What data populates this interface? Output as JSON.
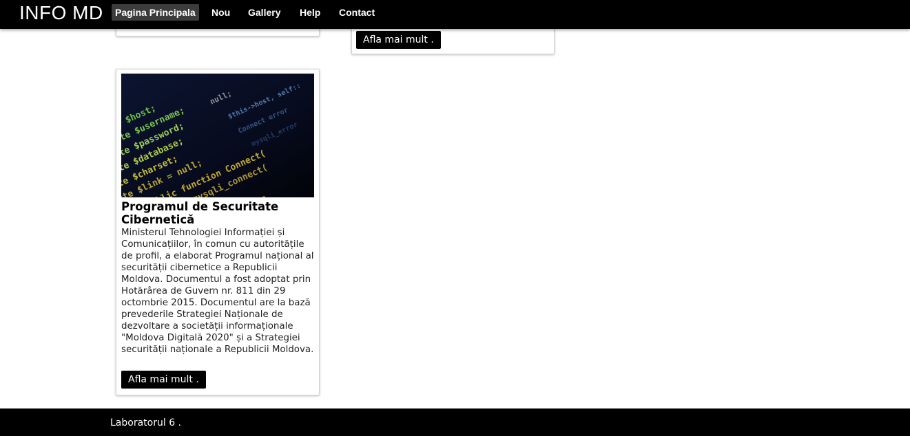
{
  "navbar": {
    "brand": "INFO MD",
    "items": [
      {
        "label": "Pagina Principala",
        "active": true
      },
      {
        "label": "Nou"
      },
      {
        "label": "Gallery"
      },
      {
        "label": "Help"
      },
      {
        "label": "Contact"
      }
    ]
  },
  "cards": {
    "top_right": {
      "button_label": "Afla mai mult ."
    },
    "main": {
      "image_icon": "code-screen-image",
      "title": "Programul de Securitate Cibernetică",
      "text": "Ministerul Tehnologiei Informației și Comunicațiilor, în comun cu autoritățile de profil, a elaborat Programul național al securității cibernetice a Republicii Moldova. Documentul a fost adoptat prin Hotărârea de Guvern nr. 811 din 29 octombrie 2015. Documentul are la bază prevederile Strategiei Naționale de dezvoltare a societății informaționale \"Moldova Digitală 2020\" și a Strategiei securității naționale a Republicii Moldova.",
      "button_label": "Afla mai mult ."
    }
  },
  "footer": {
    "text": "Laboratorul 6 ."
  },
  "colors": {
    "navbar_bg": "#000000",
    "active_nav_bg": "#3c3c3c",
    "button_bg": "#000000",
    "footer_bg": "#000000"
  }
}
